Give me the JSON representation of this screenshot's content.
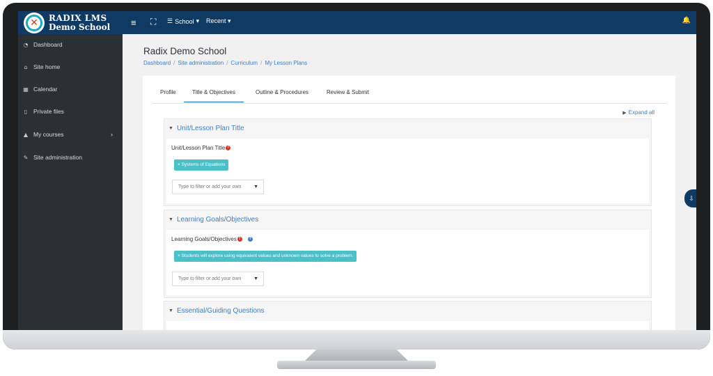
{
  "brand": {
    "line1": "RADIX LMS",
    "line2": "Demo School"
  },
  "navbar": {
    "menu_icon": "hamburger-icon",
    "fullscreen_icon": "fullscreen-icon",
    "school_label": "School",
    "recent_label": "Recent",
    "bell_icon": "bell-icon"
  },
  "sidebar": {
    "items": [
      {
        "label": "Dashboard",
        "icon": "dashboard-icon"
      },
      {
        "label": "Site home",
        "icon": "home-icon"
      },
      {
        "label": "Calendar",
        "icon": "calendar-icon"
      },
      {
        "label": "Private files",
        "icon": "file-icon"
      },
      {
        "label": "My courses",
        "icon": "graduation-cap-icon"
      },
      {
        "label": "Site administration",
        "icon": "wrench-icon"
      }
    ]
  },
  "page": {
    "title": "Radix Demo School",
    "breadcrumb": [
      "Dashboard",
      "Site administration",
      "Curriculum",
      "My Lesson Plans"
    ]
  },
  "tabs": [
    "Profile",
    "Title & Objectives",
    "Outline & Procedures",
    "Review & Submit"
  ],
  "active_tab": "Title & Objectives",
  "expand_all": "Expand all",
  "sections": [
    {
      "title": "Unit/Lesson Plan Title",
      "field_label": "Unit/Lesson Plan Title",
      "tag": "× Systems of Equations",
      "filter_placeholder": "Type to filter or add your own"
    },
    {
      "title": "Learning Goals/Objectives",
      "field_label": "Learning Goals/Objectives",
      "tag": "× Students will explore using equivalent values and unknown values to solve a problem.",
      "filter_placeholder": "Type to filter or add your own"
    },
    {
      "title": "Essential/Guiding Questions"
    }
  ],
  "colors": {
    "navbar": "#0f3a63",
    "sidebar": "#2b3034",
    "link": "#3d7ec0",
    "tag": "#4bc0c9"
  }
}
